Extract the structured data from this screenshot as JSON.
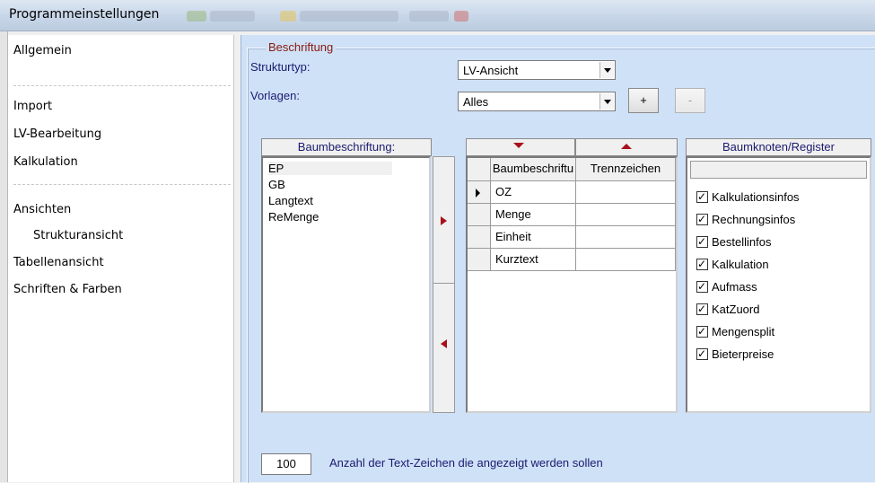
{
  "window": {
    "title": "Programmeinstellungen"
  },
  "nav": {
    "items": [
      {
        "label": "Allgemein"
      },
      {
        "label": "Import"
      },
      {
        "label": "LV-Bearbeitung"
      },
      {
        "label": "Kalkulation"
      },
      {
        "label": "Ansichten"
      },
      {
        "label": "Strukturansicht"
      },
      {
        "label": "Tabellenansicht"
      },
      {
        "label": "Schriften & Farben"
      }
    ]
  },
  "settings": {
    "group_title": "Beschriftung",
    "strukturtyp_label": "Strukturtyp:",
    "strukturtyp_value": "LV-Ansicht",
    "vorlagen_label": "Vorlagen:",
    "vorlagen_value": "Alles",
    "add_label": "+",
    "remove_label": "-",
    "baumbeschriftung_header": "Baumbeschriftung:",
    "available_items": [
      "EP",
      "GB",
      "Langtext",
      "ReMenge"
    ],
    "grid": {
      "columns": [
        "Baumbeschriftu",
        "Trennzeichen"
      ],
      "rows": [
        {
          "name": "OZ",
          "sep": ""
        },
        {
          "name": "Menge",
          "sep": ""
        },
        {
          "name": "Einheit",
          "sep": ""
        },
        {
          "name": "Kurztext",
          "sep": ""
        }
      ]
    },
    "register_header": "Baumknoten/Register",
    "register_filter": "",
    "register_items": [
      {
        "label": "Kalkulationsinfos",
        "checked": true
      },
      {
        "label": "Rechnungsinfos",
        "checked": true
      },
      {
        "label": "Bestellinfos",
        "checked": true
      },
      {
        "label": "Kalkulation",
        "checked": true
      },
      {
        "label": "Aufmass",
        "checked": true
      },
      {
        "label": "KatZuord",
        "checked": true
      },
      {
        "label": "Mengensplit",
        "checked": true
      },
      {
        "label": "Bieterpreise",
        "checked": true
      }
    ],
    "char_count_value": "100",
    "char_count_label": "Anzahl der Text-Zeichen die angezeigt werden sollen"
  },
  "colors": {
    "panel_bg": "#cfe1f7",
    "accent_red": "#a8101a",
    "group_title": "#8a1a0f"
  }
}
